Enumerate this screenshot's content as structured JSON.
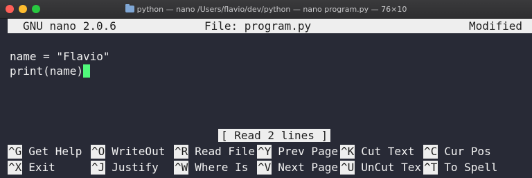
{
  "window": {
    "title": "python — nano /Users/flavio/dev/python — nano program.py — 76×10"
  },
  "header": {
    "version": "GNU nano 2.0.6",
    "file": "File: program.py",
    "status": "Modified"
  },
  "editor": {
    "lines": [
      "name = \"Flavio\"",
      "print(name)"
    ]
  },
  "status_message": "[ Read 2 lines ]",
  "shortcuts": {
    "row1": [
      {
        "key": "^G",
        "label": "Get Help"
      },
      {
        "key": "^O",
        "label": "WriteOut"
      },
      {
        "key": "^R",
        "label": "Read File"
      },
      {
        "key": "^Y",
        "label": "Prev Page"
      },
      {
        "key": "^K",
        "label": "Cut Text"
      },
      {
        "key": "^C",
        "label": "Cur Pos"
      }
    ],
    "row2": [
      {
        "key": "^X",
        "label": "Exit"
      },
      {
        "key": "^J",
        "label": "Justify"
      },
      {
        "key": "^W",
        "label": "Where Is"
      },
      {
        "key": "^V",
        "label": "Next Page"
      },
      {
        "key": "^U",
        "label": "UnCut Tex"
      },
      {
        "key": "^T",
        "label": "To Spell"
      }
    ]
  },
  "colors": {
    "background": "#282a36",
    "cursor": "#50fa7b",
    "inverse_bg": "#eeeeee"
  }
}
